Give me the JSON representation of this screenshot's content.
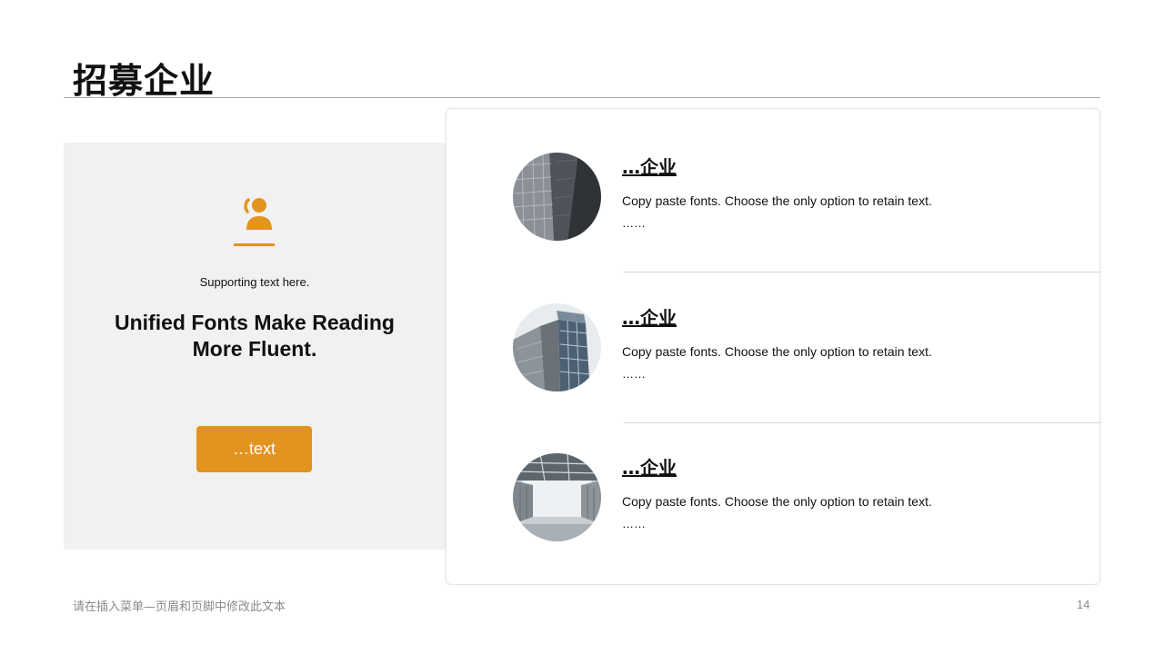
{
  "slide": {
    "title": "招募企业",
    "accent_color": "#e2941f",
    "panel_background": "#f1f1f1"
  },
  "left_panel": {
    "icon": "person-icon",
    "supporting_text": "Supporting  text here.",
    "headline": "Unified Fonts Make Reading More Fluent.",
    "button_label": "…text"
  },
  "items": [
    {
      "title": "…企业",
      "description": "Copy paste fonts. Choose the only option to retain text.",
      "more": "……",
      "image": "skyscraper-photo"
    },
    {
      "title": "…企业",
      "description": "Copy paste fonts. Choose the only option to retain text.",
      "more": "……",
      "image": "glass-tower-photo"
    },
    {
      "title": "…企业",
      "description": "Copy paste fonts. Choose the only option to retain text.",
      "more": "……",
      "image": "interior-atrium-photo"
    }
  ],
  "footer": {
    "text": "请在插入菜单—页眉和页脚中修改此文本",
    "page_number": "14"
  }
}
